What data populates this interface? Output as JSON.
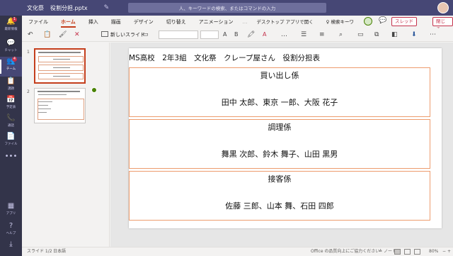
{
  "titlebar": {
    "team": "文化祭",
    "filename": "役割分担.pptx",
    "search_placeholder": "人、キーワードの検索、またはコマンドの入力"
  },
  "rail": {
    "items": [
      {
        "label": "最新情報",
        "icon": "bell-icon",
        "glyph": "🔔",
        "badge": "1"
      },
      {
        "label": "チャット",
        "icon": "chat-icon",
        "glyph": "💬",
        "badge": ""
      },
      {
        "label": "チーム",
        "icon": "teams-icon",
        "glyph": "👥",
        "badge": "4",
        "active": true
      },
      {
        "label": "課題",
        "icon": "assignment-icon",
        "glyph": "📋",
        "badge": ""
      },
      {
        "label": "予定表",
        "icon": "calendar-icon",
        "glyph": "📅",
        "badge": ""
      },
      {
        "label": "通話",
        "icon": "phone-icon",
        "glyph": "📞",
        "badge": ""
      },
      {
        "label": "ファイル",
        "icon": "file-icon",
        "glyph": "📄",
        "badge": ""
      },
      {
        "label": "",
        "icon": "more-icon",
        "glyph": "•••",
        "badge": ""
      }
    ],
    "bottom": [
      {
        "label": "アプリ",
        "icon": "apps-icon",
        "glyph": "▦"
      },
      {
        "label": "ヘルプ",
        "icon": "help-icon",
        "glyph": "?"
      },
      {
        "label": "",
        "icon": "download-icon",
        "glyph": "⤓"
      }
    ]
  },
  "ribbon": {
    "tabs": [
      "ファイル",
      "ホーム",
      "挿入",
      "描画",
      "デザイン",
      "切り替え",
      "アニメーション"
    ],
    "active_tab": "ホーム",
    "more": "…",
    "open_desktop": "デスクトップ アプリで開く",
    "tell_me": "検索キーワ",
    "thread_label": "スレッド",
    "close_label": "閉じる",
    "new_slide_label": "新しいスライド"
  },
  "thumbnails": [
    {
      "number": "1",
      "selected": true
    },
    {
      "number": "2",
      "selected": false
    }
  ],
  "slide": {
    "title": "MS高校　2年3組　文化祭　クレープ屋さん　役割分担表",
    "roles": [
      {
        "name": "買い出し係",
        "members": "田中 太郎、東京 一郎、大阪 花子"
      },
      {
        "name": "調理係",
        "members": "舞黒 次郎、鈴木 舞子、山田 黒男"
      },
      {
        "name": "接客係",
        "members": "佐藤 三郎、山本 舞、石田 四郎"
      }
    ]
  },
  "status": {
    "slide_position": "スライド 1/2",
    "language": "日本語",
    "improve": "Office の品質向上にご協力ください",
    "notes": "ノート",
    "zoom": "80%"
  },
  "colors": {
    "rail_bg": "#33344a",
    "titlebar_bg": "#464775",
    "accent": "#c43e1c",
    "box_border": "#ed9c6e"
  }
}
